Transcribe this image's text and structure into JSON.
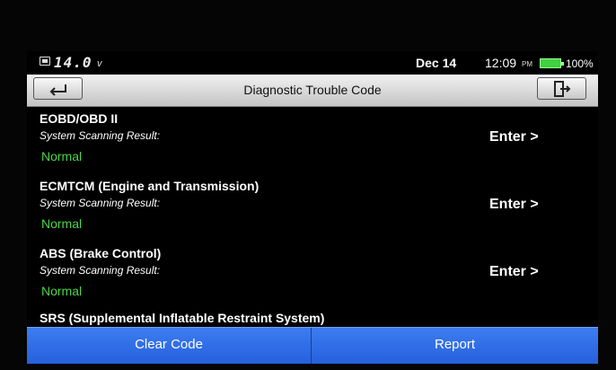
{
  "status_bar": {
    "voltage": "14.0",
    "voltage_unit": "v",
    "date": "Dec 14",
    "time": "12:09",
    "ampm": "PM",
    "battery_percent": "100%",
    "battery_color": "#3fd13f"
  },
  "titlebar": {
    "title": "Diagnostic Trouble Code",
    "back_icon": "back-arrow-icon",
    "exit_icon": "exit-icon"
  },
  "results": [
    {
      "system": "EOBD/OBD II",
      "label": "System Scanning Result:",
      "status": "Normal",
      "action": "Enter >"
    },
    {
      "system": "ECMTCM (Engine and Transmission)",
      "label": "System Scanning Result:",
      "status": "Normal",
      "action": "Enter >"
    },
    {
      "system": "ABS (Brake Control)",
      "label": "System Scanning Result:",
      "status": "Normal",
      "action": "Enter >"
    },
    {
      "system": "SRS (Supplemental Inflatable Restraint System)"
    }
  ],
  "bottom_bar": {
    "clear_label": "Clear Code",
    "report_label": "Report",
    "accent": "#2f6fe8"
  },
  "colors": {
    "status_ok": "#4bd64b",
    "background": "#000000"
  }
}
